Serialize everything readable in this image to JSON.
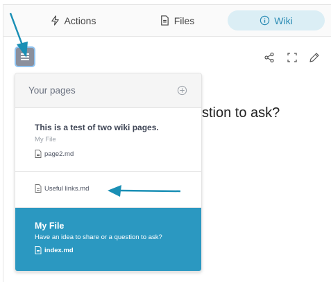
{
  "tabs": [
    {
      "label": "Actions",
      "icon": "bolt-icon"
    },
    {
      "label": "Files",
      "icon": "file-icon"
    },
    {
      "label": "Wiki",
      "icon": "info-icon",
      "active": true
    }
  ],
  "toolbar": {
    "menu_icon": "hamburger-icon",
    "actions": [
      "share-icon",
      "fullscreen-icon",
      "edit-icon"
    ]
  },
  "content": {
    "heading_visible": "stion to ask?"
  },
  "panel": {
    "title": "Your pages",
    "items": [
      {
        "title": "This is a test of two wiki pages.",
        "subtitle": "My File",
        "file": "page2.md"
      },
      {
        "file": "Useful links.md"
      },
      {
        "title": "My File",
        "subtitle": "Have an idea to share or a question to ask?",
        "file": "index.md",
        "active": true
      }
    ]
  },
  "colors": {
    "accent": "#2b98c1",
    "tab_active_bg": "#dbeef5",
    "annotation_arrow": "#1a8fb5"
  }
}
